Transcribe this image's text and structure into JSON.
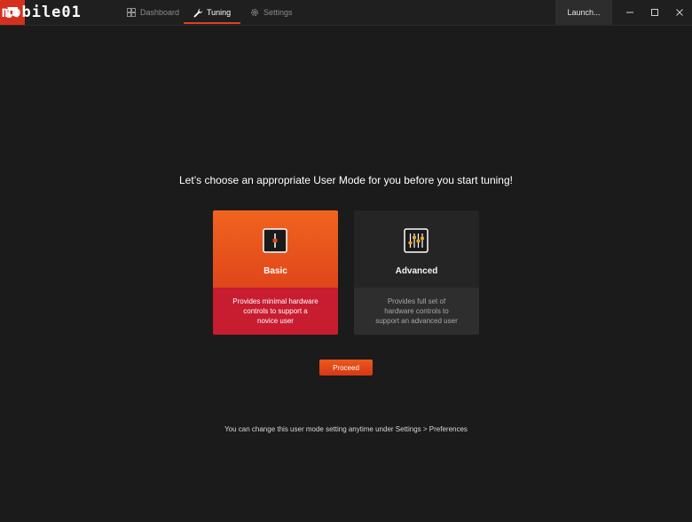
{
  "titlebar": {
    "app_name": "",
    "watermark": "mobile01",
    "tabs": [
      {
        "label": "Dashboard",
        "icon": "dashboard-icon"
      },
      {
        "label": "Tuning",
        "icon": "wrench-icon"
      },
      {
        "label": "Settings",
        "icon": "gear-icon"
      }
    ],
    "active_tab": "Tuning",
    "launch_label": "Launch...",
    "window_controls": [
      "minimize-icon",
      "maximize-icon",
      "close-icon"
    ]
  },
  "main": {
    "heading": "Let’s choose an appropriate User Mode for you before you start tuning!",
    "cards": {
      "basic": {
        "title": "Basic",
        "description": "Provides minimal hardware controls to support a novice user",
        "icon": "single-slider-icon",
        "selected": true
      },
      "advanced": {
        "title": "Advanced",
        "description": "Provides full set of hardware controls to support an advanced user",
        "icon": "multi-slider-icon",
        "selected": false
      }
    },
    "proceed_label": "Proceed",
    "footer_note": "You can change this user mode setting anytime under Settings > Preferences"
  },
  "colors": {
    "accent": "#e0461a",
    "basic_bottom": "#c81c30",
    "background": "#1b1b1b"
  }
}
